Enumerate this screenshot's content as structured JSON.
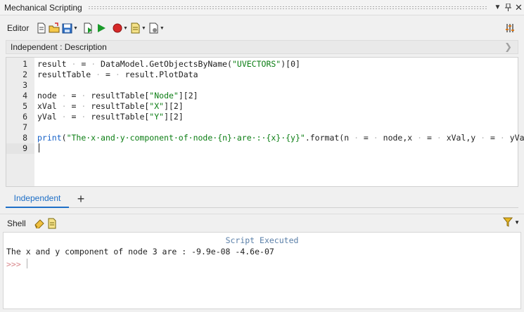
{
  "window": {
    "title": "Mechanical Scripting"
  },
  "toolbar": {
    "label": "Editor"
  },
  "description_bar": {
    "text": "Independent  : Description"
  },
  "editor": {
    "lines": [
      {
        "num": "1",
        "tokens": [
          {
            "t": "result",
            "c": ""
          },
          {
            "t": " · ",
            "c": "dot"
          },
          {
            "t": "=",
            "c": ""
          },
          {
            "t": " · ",
            "c": "dot"
          },
          {
            "t": "DataModel.GetObjectsByName(",
            "c": ""
          },
          {
            "t": "\"UVECTORS\"",
            "c": "str"
          },
          {
            "t": ")[0]",
            "c": ""
          }
        ]
      },
      {
        "num": "2",
        "tokens": [
          {
            "t": "resultTable",
            "c": ""
          },
          {
            "t": " · ",
            "c": "dot"
          },
          {
            "t": "=",
            "c": ""
          },
          {
            "t": " · ",
            "c": "dot"
          },
          {
            "t": "result.PlotData",
            "c": ""
          }
        ]
      },
      {
        "num": "3",
        "tokens": []
      },
      {
        "num": "4",
        "tokens": [
          {
            "t": "node",
            "c": ""
          },
          {
            "t": " · ",
            "c": "dot"
          },
          {
            "t": "=",
            "c": ""
          },
          {
            "t": " · ",
            "c": "dot"
          },
          {
            "t": "resultTable[",
            "c": ""
          },
          {
            "t": "\"Node\"",
            "c": "str"
          },
          {
            "t": "][2]",
            "c": ""
          }
        ]
      },
      {
        "num": "5",
        "tokens": [
          {
            "t": "xVal",
            "c": ""
          },
          {
            "t": " · ",
            "c": "dot"
          },
          {
            "t": "=",
            "c": ""
          },
          {
            "t": " · ",
            "c": "dot"
          },
          {
            "t": "resultTable[",
            "c": ""
          },
          {
            "t": "\"X\"",
            "c": "str"
          },
          {
            "t": "][2]",
            "c": ""
          }
        ]
      },
      {
        "num": "6",
        "tokens": [
          {
            "t": "yVal",
            "c": ""
          },
          {
            "t": " · ",
            "c": "dot"
          },
          {
            "t": "=",
            "c": ""
          },
          {
            "t": " · ",
            "c": "dot"
          },
          {
            "t": "resultTable[",
            "c": ""
          },
          {
            "t": "\"Y\"",
            "c": "str"
          },
          {
            "t": "][2]",
            "c": ""
          }
        ]
      },
      {
        "num": "7",
        "tokens": []
      },
      {
        "num": "8",
        "tokens": [
          {
            "t": "print",
            "c": "kw"
          },
          {
            "t": "(",
            "c": ""
          },
          {
            "t": "\"The·x·and·y·component·of·node·{n}·are·:·{x}·{y}\"",
            "c": "str"
          },
          {
            "t": ".format(n",
            "c": ""
          },
          {
            "t": " · ",
            "c": "dot"
          },
          {
            "t": "=",
            "c": ""
          },
          {
            "t": " · ",
            "c": "dot"
          },
          {
            "t": "node,x",
            "c": ""
          },
          {
            "t": " · ",
            "c": "dot"
          },
          {
            "t": "=",
            "c": ""
          },
          {
            "t": " · ",
            "c": "dot"
          },
          {
            "t": "xVal,y",
            "c": ""
          },
          {
            "t": " · ",
            "c": "dot"
          },
          {
            "t": "=",
            "c": ""
          },
          {
            "t": " · ",
            "c": "dot"
          },
          {
            "t": "yVal))",
            "c": ""
          }
        ]
      },
      {
        "num": "9",
        "tokens": [],
        "current": true
      }
    ]
  },
  "tabs": {
    "active_label": "Independent",
    "add_label": "+"
  },
  "shell": {
    "label": "Shell",
    "executed_text": "Script Executed",
    "output_text": "The x and y component of node 3 are : -9.9e-08 -4.6e-07",
    "prompt_text": ">>>"
  },
  "colors": {
    "string": "#0a7d12",
    "keyword": "#1460c8",
    "tab_active": "#1e6fc7",
    "record": "#d62828",
    "run": "#1a9a2a"
  },
  "icons": {
    "toolbar": [
      "new-file-icon",
      "open-folder-icon",
      "save-icon",
      "run-with-debug-icon",
      "run-icon",
      "record-icon",
      "snippets-icon",
      "options-icon",
      "settings-sliders-icon"
    ],
    "shell": [
      "eraser-icon",
      "copy-icon",
      "filter-icon"
    ]
  }
}
